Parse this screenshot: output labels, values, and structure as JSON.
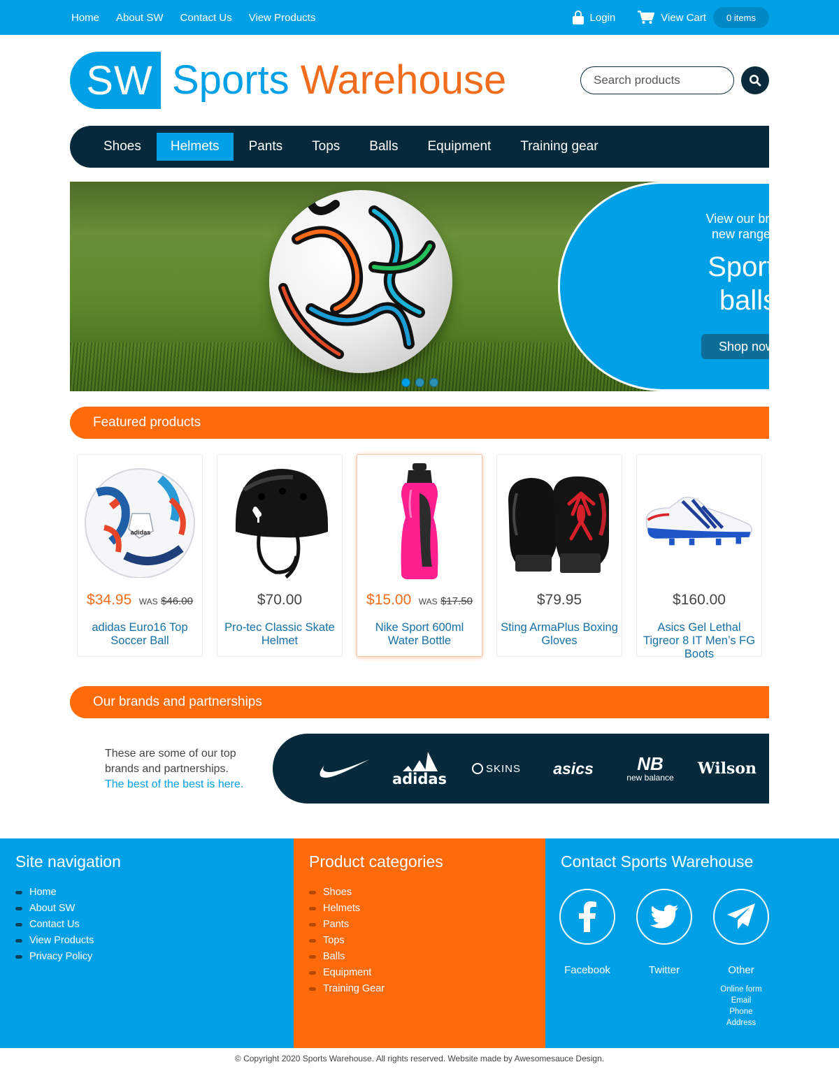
{
  "topbar": {
    "links": [
      "Home",
      "About SW",
      "Contact Us",
      "View Products"
    ],
    "login_label": "Login",
    "cart_label": "View Cart",
    "cart_count": "0 items"
  },
  "header": {
    "logo_badge": "SW",
    "logo_word1": "Sports",
    "logo_word2": "Warehouse",
    "search_placeholder": "Search products"
  },
  "nav": {
    "items": [
      "Shoes",
      "Helmets",
      "Pants",
      "Tops",
      "Balls",
      "Equipment",
      "Training gear"
    ],
    "active": "Helmets"
  },
  "hero": {
    "line1": "View our brand",
    "line2": "new range of",
    "title1": "Sports",
    "title2": "balls",
    "button": "Shop now"
  },
  "featured": {
    "title": "Featured products",
    "was_label": "WAS",
    "products": [
      {
        "price": "$34.95",
        "old_price": "$46.00",
        "name": "adidas Euro16 Top Soccer Ball",
        "sale": true
      },
      {
        "price": "$70.00",
        "old_price": "",
        "name": "Pro-tec Classic Skate Helmet",
        "sale": false
      },
      {
        "price": "$15.00",
        "old_price": "$17.50",
        "name": "Nike Sport 600ml Water Bottle",
        "sale": true
      },
      {
        "price": "$79.95",
        "old_price": "",
        "name": "Sting ArmaPlus Boxing Gloves",
        "sale": false
      },
      {
        "price": "$160.00",
        "old_price": "",
        "name": "Asics Gel Lethal Tigreor 8 IT Men’s FG Boots",
        "sale": false
      }
    ]
  },
  "brands": {
    "title": "Our brands and partnerships",
    "text": "These are some of our top brands and partnerships.",
    "highlight": "The best of the best is here.",
    "logos": [
      "nike",
      "adidas",
      "SKINS",
      "asics",
      "new balance",
      "Wilson"
    ]
  },
  "footer": {
    "nav_title": "Site navigation",
    "nav_links": [
      "Home",
      "About SW",
      "Contact Us",
      "View Products",
      "Privacy Policy"
    ],
    "cat_title": "Product categories",
    "cat_links": [
      "Shoes",
      "Helmets",
      "Pants",
      "Tops",
      "Balls",
      "Equipment",
      "Training Gear"
    ],
    "contact_title": "Contact Sports Warehouse",
    "social": [
      "Facebook",
      "Twitter",
      "Other"
    ],
    "other_items": [
      "Online form",
      "Email",
      "Phone",
      "Address"
    ],
    "copyright": "© Copyright 2020 Sports Warehouse. All rights reserved. Website made by Awesomesauce Design."
  },
  "colors": {
    "blue": "#00a0e6",
    "orange": "#ff6a0a",
    "navy": "#062a3b"
  }
}
